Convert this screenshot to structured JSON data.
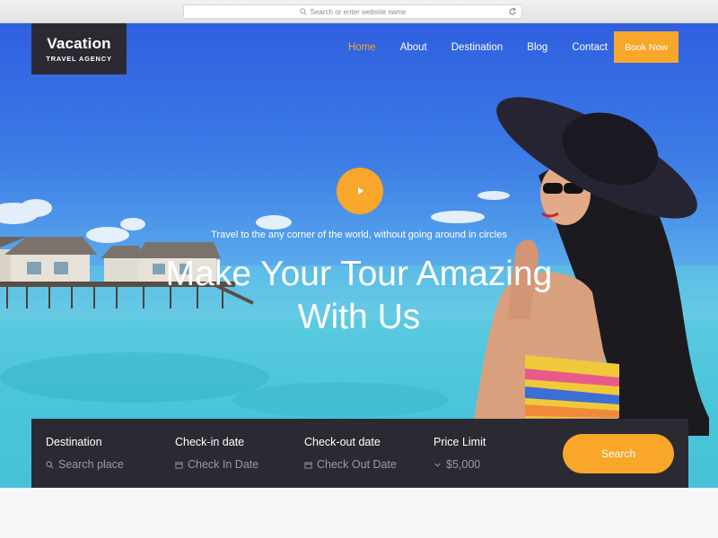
{
  "browser": {
    "address_placeholder": "Search or enter website name"
  },
  "logo": {
    "title": "Vacation",
    "subtitle": "TRAVEL AGENCY"
  },
  "nav": {
    "items": [
      {
        "label": "Home",
        "active": true
      },
      {
        "label": "About",
        "active": false
      },
      {
        "label": "Destination",
        "active": false
      },
      {
        "label": "Blog",
        "active": false
      },
      {
        "label": "Contact",
        "active": false
      }
    ],
    "book_label": "Book Now"
  },
  "hero": {
    "tagline": "Travel to the any corner of the world, without going around in circles",
    "headline_line1": "Make Your Tour Amazing",
    "headline_line2": "With Us",
    "play_icon": "play-icon"
  },
  "search": {
    "fields": [
      {
        "label": "Destination",
        "value": "Search place",
        "icon": "search-icon"
      },
      {
        "label": "Check-in date",
        "value": "Check In Date",
        "icon": "calendar-icon"
      },
      {
        "label": "Check-out date",
        "value": "Check Out Date",
        "icon": "calendar-icon"
      },
      {
        "label": "Price Limit",
        "value": "$5,000",
        "icon": "chevron-down-icon"
      }
    ],
    "button_label": "Search"
  },
  "colors": {
    "accent": "#f8a72a",
    "dark": "#2b2a33",
    "active_nav": "#f6a728"
  }
}
